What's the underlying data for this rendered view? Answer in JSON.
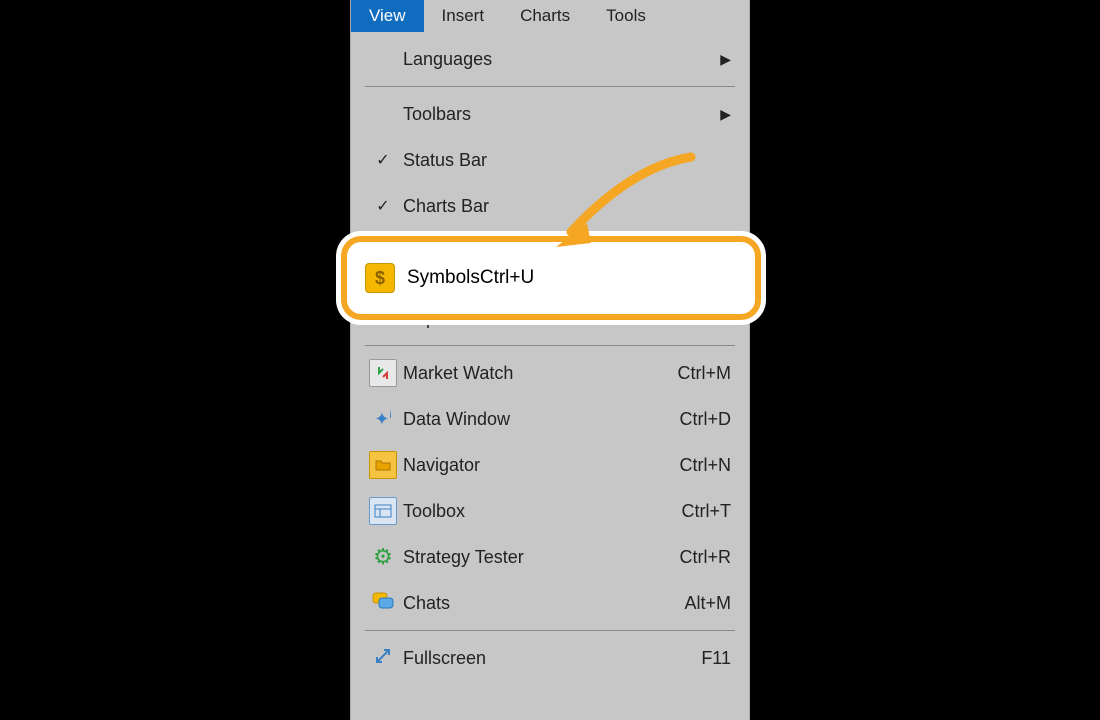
{
  "menubar": {
    "items": [
      {
        "label": "View",
        "active": true
      },
      {
        "label": "Insert",
        "active": false
      },
      {
        "label": "Charts",
        "active": false
      },
      {
        "label": "Tools",
        "active": false
      }
    ]
  },
  "dropdown": {
    "languages": "Languages",
    "toolbars": "Toolbars",
    "status_bar": "Status Bar",
    "charts_bar": "Charts Bar",
    "symbols": {
      "label": "Symbols",
      "shortcut": "Ctrl+U"
    },
    "depth_of_market": "Depth Of Market",
    "market_watch": {
      "label": "Market Watch",
      "shortcut": "Ctrl+M"
    },
    "data_window": {
      "label": "Data Window",
      "shortcut": "Ctrl+D"
    },
    "navigator": {
      "label": "Navigator",
      "shortcut": "Ctrl+N"
    },
    "toolbox": {
      "label": "Toolbox",
      "shortcut": "Ctrl+T"
    },
    "strategy_tester": {
      "label": "Strategy Tester",
      "shortcut": "Ctrl+R"
    },
    "chats": {
      "label": "Chats",
      "shortcut": "Alt+M"
    },
    "fullscreen": {
      "label": "Fullscreen",
      "shortcut": "F11"
    }
  },
  "colors": {
    "menubar_active": "#0f6cbf",
    "highlight": "#f5a623"
  }
}
